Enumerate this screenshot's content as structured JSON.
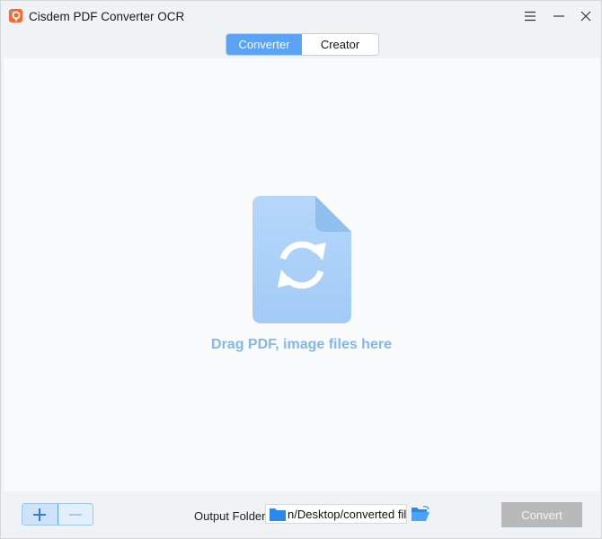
{
  "app": {
    "title": "Cisdem PDF Converter OCR",
    "logo_icon": "cisdem-logo-icon",
    "window_controls": [
      "menu-icon",
      "minimize-icon",
      "close-icon"
    ]
  },
  "tabs": [
    {
      "label": "Converter",
      "active": true
    },
    {
      "label": "Creator",
      "active": false
    }
  ],
  "main": {
    "drop_icon": "file-convert-icon",
    "drop_text": "Drag PDF, image files here"
  },
  "footer": {
    "add_icon": "plus-icon",
    "remove_icon": "minus-icon",
    "output_label": "Output Folder",
    "output_path": "n/Desktop/converted file",
    "browse_icon": "open-folder-icon",
    "convert_label": "Convert",
    "convert_enabled": false
  },
  "colors": {
    "accent": "#5aa3f5",
    "drop_text": "#83b8eb",
    "disabled_button": "#b9b9b9"
  }
}
